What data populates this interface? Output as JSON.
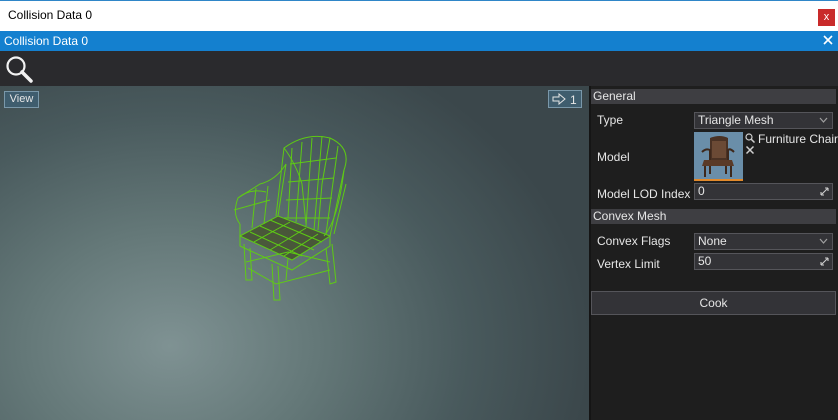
{
  "window": {
    "title": "Collision Data 0",
    "close_label": "x"
  },
  "tab": {
    "title": "Collision Data 0"
  },
  "toolbar": {
    "search_icon": "search-icon"
  },
  "viewport": {
    "view_button": "View",
    "camera_speed": "1",
    "colors": {
      "wireframe": "#5fd010",
      "background": "#647878"
    }
  },
  "properties": {
    "general": {
      "header": "General",
      "type_label": "Type",
      "type_value": "Triangle Mesh",
      "model_label": "Model",
      "model_asset": "Furniture Chair",
      "lod_label": "Model LOD Index",
      "lod_value": "0"
    },
    "convex": {
      "header": "Convex Mesh",
      "flags_label": "Convex Flags",
      "flags_value": "None",
      "vertex_label": "Vertex Limit",
      "vertex_value": "50"
    },
    "cook_button": "Cook"
  }
}
